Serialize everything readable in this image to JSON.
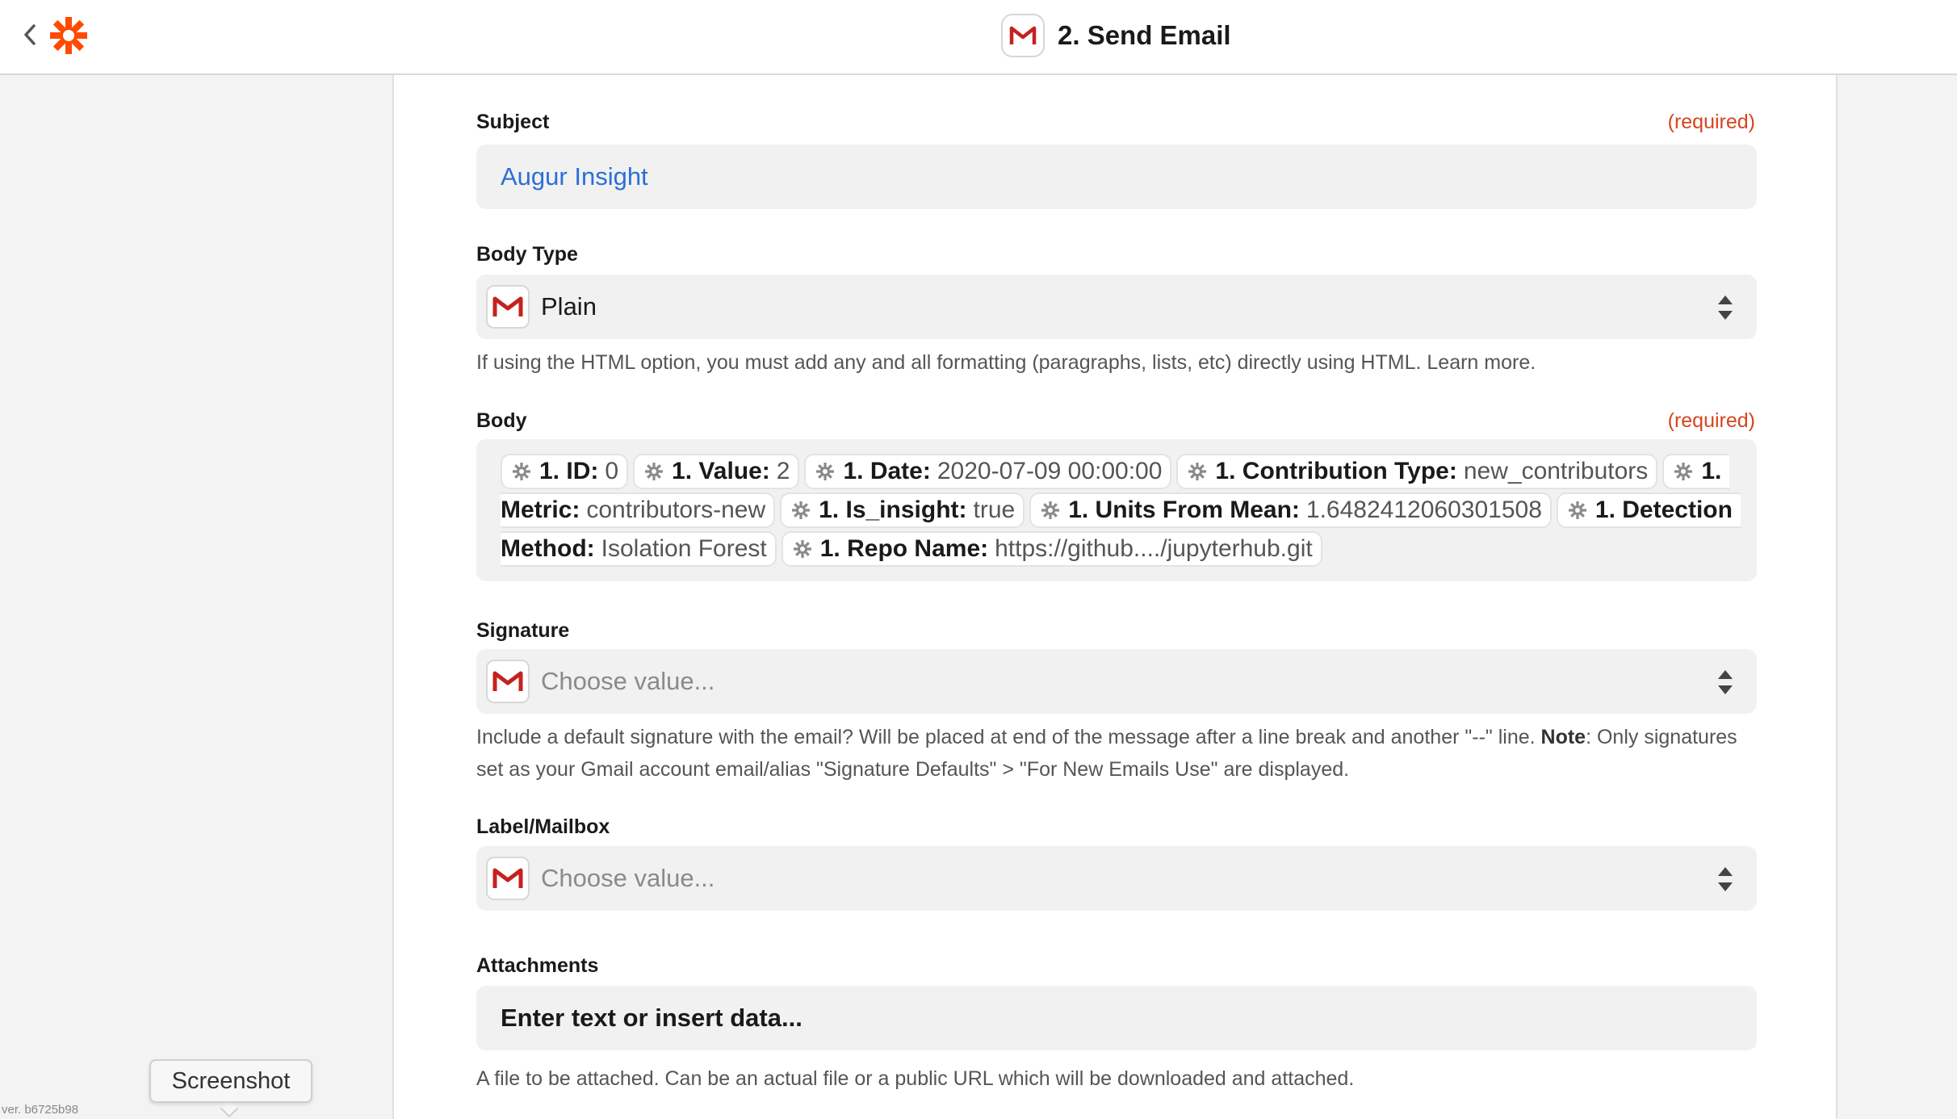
{
  "header": {
    "title": "2. Send Email",
    "app_icon": "gmail-icon",
    "brand_color": "#ff4a00"
  },
  "form": {
    "cut_off_text": "",
    "subject": {
      "label": "Subject",
      "required": "(required)",
      "value": "Augur Insight"
    },
    "body_type": {
      "label": "Body Type",
      "value": "Plain",
      "help": "If using the HTML option, you must add any and all formatting (paragraphs, lists, etc) directly using HTML. Learn more."
    },
    "body": {
      "label": "Body",
      "required": "(required)",
      "pills": [
        {
          "key": "1. ID:",
          "value": "0"
        },
        {
          "key": "1. Value:",
          "value": "2"
        },
        {
          "key": "1. Date:",
          "value": "2020-07-09 00:00:00"
        },
        {
          "key": "1. Contribution Type:",
          "value": "new_contributors"
        },
        {
          "key_a": "1.",
          "key_b": "Metric:",
          "value": "contributors-new"
        },
        {
          "key": "1. Is_insight:",
          "value": "true"
        },
        {
          "key": "1. Units From Mean:",
          "value": "1.6482412060301508"
        },
        {
          "key_a": "1. Detection",
          "key_b": "Method:",
          "value": "Isolation Forest"
        },
        {
          "key": "1. Repo Name:",
          "value": "https://github..../jupyterhub.git"
        }
      ]
    },
    "signature": {
      "label": "Signature",
      "placeholder": "Choose value...",
      "help_pre": "Include a default signature with the email? Will be placed at end of the message after a line break and another \"--\" line. ",
      "help_bold": "Note",
      "help_post": ": Only signatures set as your Gmail account email/alias \"Signature Defaults\" > \"For New Emails Use\" are displayed."
    },
    "label_mailbox": {
      "label": "Label/Mailbox",
      "placeholder": "Choose value..."
    },
    "attachments": {
      "label": "Attachments",
      "placeholder": "Enter text or insert data...",
      "help": "A file to be attached. Can be an actual file or a public URL which will be downloaded and attached."
    }
  },
  "tooltip": {
    "label": "Screenshot"
  },
  "footer": {
    "version": "ver. b6725b98"
  }
}
